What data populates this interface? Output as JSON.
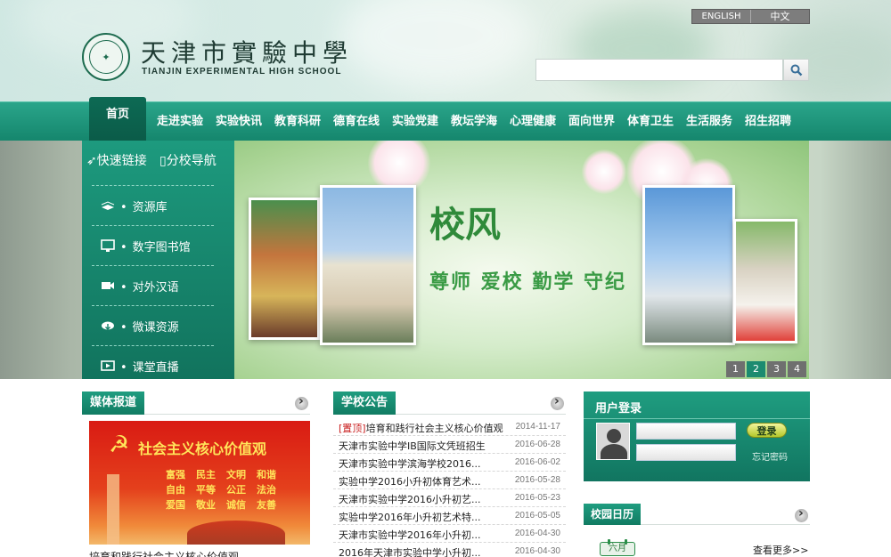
{
  "header": {
    "logo_cn": "天津市實驗中學",
    "logo_en": "TIANJIN EXPERIMENTAL HIGH SCHOOL",
    "lang": [
      "ENGLISH",
      "中文"
    ],
    "search_placeholder": ""
  },
  "nav": {
    "home": "首页",
    "items": [
      "走进实验",
      "实验快讯",
      "教育科研",
      "德育在线",
      "实验党建",
      "教坛学海",
      "心理健康",
      "面向世界",
      "体育卫生",
      "生活服务",
      "招生招聘"
    ]
  },
  "side": {
    "tabs": [
      "快速链接",
      "分校导航"
    ],
    "links": [
      "资源库",
      "数字图书馆",
      "对外汉语",
      "微课资源",
      "课堂直播"
    ]
  },
  "banner": {
    "title": "校风",
    "subtitle": "尊师  爱校  勤学  守纪",
    "pages": [
      "1",
      "2",
      "3",
      "4"
    ],
    "active_page": 2
  },
  "media": {
    "heading": "媒体报道",
    "poster_title": "社会主义核心价值观",
    "poster_values": [
      [
        "富强",
        "民主",
        "文明",
        "和谐"
      ],
      [
        "自由",
        "平等",
        "公正",
        "法治"
      ],
      [
        "爱国",
        "敬业",
        "诚信",
        "友善"
      ]
    ],
    "caption": "培育和践行社会主义核心价值观"
  },
  "notices": {
    "heading": "学校公告",
    "pin_label": "[置顶]",
    "items": [
      {
        "title": "培育和践行社会主义核心价值观",
        "date": "2014-11-17",
        "pinned": true
      },
      {
        "title": "天津市实验中学IB国际文凭班招生",
        "date": "2016-06-28"
      },
      {
        "title": "天津市实验中学滨海学校2016...",
        "date": "2016-06-02"
      },
      {
        "title": "实验中学2016小升初体育艺术...",
        "date": "2016-05-28"
      },
      {
        "title": "天津市实验中学2016小升初艺...",
        "date": "2016-05-23"
      },
      {
        "title": "实验中学2016年小升初艺术特...",
        "date": "2016-05-05"
      },
      {
        "title": "天津市实验中学2016年小升初...",
        "date": "2016-04-30"
      },
      {
        "title": "2016年天津市实验中学小升初...",
        "date": "2016-04-30"
      }
    ]
  },
  "login": {
    "heading": "用户登录",
    "button": "登录",
    "forgot": "忘记密码"
  },
  "calendar": {
    "heading": "校园日历",
    "month": "六月",
    "see_more": "查看更多>>"
  }
}
